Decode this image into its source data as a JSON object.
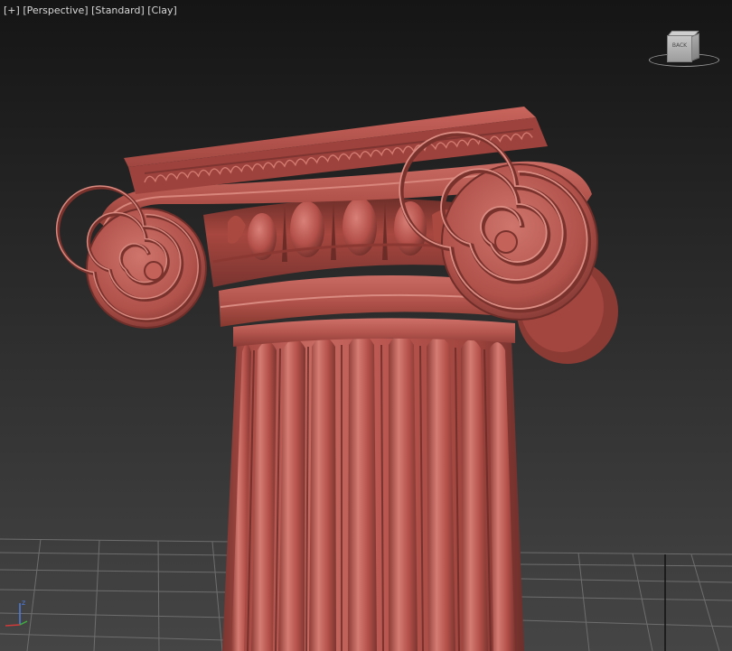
{
  "viewport": {
    "menu": {
      "plus_label": "[+]",
      "view_label": "[Perspective]",
      "shading_label": "[Standard]",
      "style_label": "[Clay]"
    },
    "viewcube": {
      "face_label": "BACK",
      "side_label": "R"
    },
    "axis": {
      "z_label": "z"
    },
    "colors": {
      "background_top": "#151515",
      "background_bottom": "#454545",
      "clay": "#b8574f",
      "grid": "#777777"
    }
  }
}
